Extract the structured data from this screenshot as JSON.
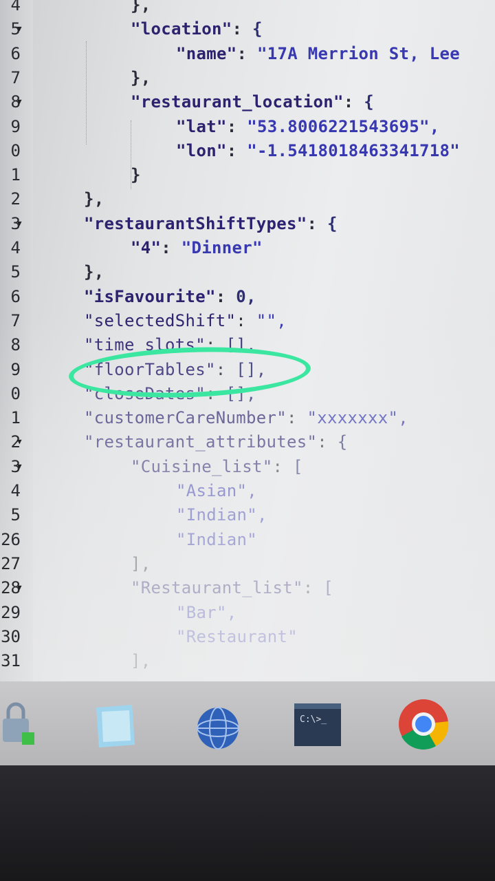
{
  "editor": {
    "line_numbers": [
      "4",
      "5",
      "6",
      "7",
      "8",
      "9",
      "0",
      "1",
      "2",
      "3",
      "4",
      "5",
      "6",
      "7",
      "8",
      "9",
      "0",
      "1",
      "2",
      "3",
      "4",
      "5",
      "26",
      "27",
      "28",
      "29",
      "30",
      "31"
    ],
    "lines": [
      {
        "indent": 2,
        "text": "},"
      },
      {
        "indent": 2,
        "text": "\"location\": {"
      },
      {
        "indent": 3,
        "text": "\"name\": \"17A Merrion St, Lee"
      },
      {
        "indent": 2,
        "text": "},"
      },
      {
        "indent": 2,
        "text": "\"restaurant_location\": {"
      },
      {
        "indent": 3,
        "text": "\"lat\": \"53.8006221543695\","
      },
      {
        "indent": 3,
        "text": "\"lon\": \"-1.5418018463341718\""
      },
      {
        "indent": 2,
        "text": "}"
      },
      {
        "indent": 1,
        "text": "},"
      },
      {
        "indent": 1,
        "text": "\"restaurantShiftTypes\": {"
      },
      {
        "indent": 2,
        "text": "\"4\": \"Dinner\""
      },
      {
        "indent": 1,
        "text": "},"
      },
      {
        "indent": 1,
        "text": "\"isFavourite\": 0,"
      },
      {
        "indent": 1,
        "text": "\"selectedShift\": \"\","
      },
      {
        "indent": 1,
        "text": "\"time_slots\": [],"
      },
      {
        "indent": 1,
        "text": "\"floorTables\": [],"
      },
      {
        "indent": 1,
        "text": "\"closeDates\": [],"
      },
      {
        "indent": 1,
        "text": "\"customerCareNumber\": \"xxxxxxx\","
      },
      {
        "indent": 1,
        "text": "\"restaurant_attributes\": {"
      },
      {
        "indent": 2,
        "text": "\"Cuisine_list\": ["
      },
      {
        "indent": 3,
        "text": "\"Asian\","
      },
      {
        "indent": 3,
        "text": "\"Indian\","
      },
      {
        "indent": 3,
        "text": "\"Indian\""
      },
      {
        "indent": 2,
        "text": "],"
      },
      {
        "indent": 2,
        "text": "\"Restaurant_list\": ["
      },
      {
        "indent": 3,
        "text": "\"Bar\","
      },
      {
        "indent": 3,
        "text": "\"Restaurant\""
      },
      {
        "indent": 2,
        "text": "],"
      }
    ],
    "fold_lines": [
      1,
      4,
      9,
      18,
      19,
      24
    ],
    "highlighted_line": 15
  },
  "taskbar": {
    "icons": [
      "lock-icon",
      "notes-icon",
      "globe-icon",
      "terminal-icon",
      "chrome-icon"
    ],
    "terminal_label": "C:\\>_"
  },
  "colors": {
    "highlight": "#3be6a0",
    "key": "#2d2270",
    "string": "#3838b0"
  }
}
